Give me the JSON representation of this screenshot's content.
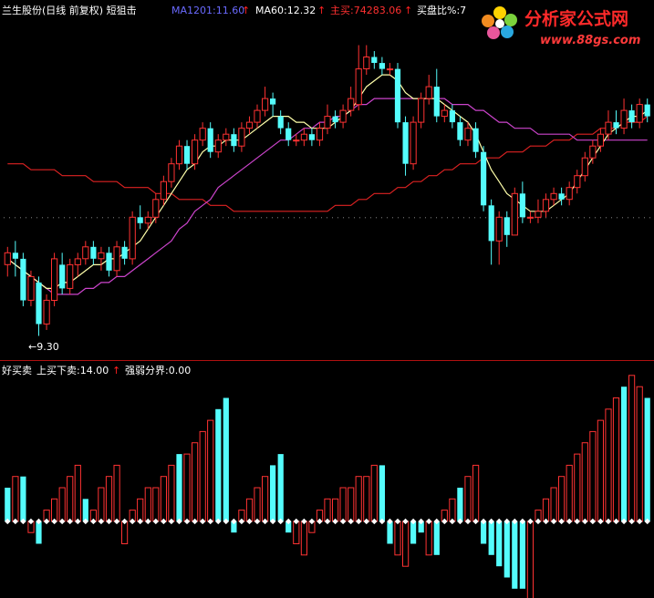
{
  "upper_header": {
    "stock_title": "兰生股份(日线 前复权) 短狙击",
    "indicators": [
      {
        "label": "MA1201:11.60",
        "color": "#6a6aff"
      },
      {
        "label": "MA60:12.32",
        "color": "#ffffff"
      },
      {
        "label": "主买:74283.06",
        "color": "#ff3030"
      },
      {
        "label": "买盘比%:7",
        "color": "#ffffff"
      }
    ],
    "arrow_color": "#ff2020",
    "arrow_glyph": "↑"
  },
  "lower_header": {
    "title": "好买卖",
    "indicators": [
      {
        "label": "上买下卖:14.00",
        "color": "#ffffff"
      },
      {
        "label": "强弱分界:0.00",
        "color": "#ffffff"
      }
    ]
  },
  "price_marker": {
    "label": "←9.30"
  },
  "watermark": {
    "brand": "分析家公式网",
    "url": "www.88gs.com"
  },
  "colors": {
    "up": "#ff3232",
    "down": "#54fcfc",
    "ma_short": "#ffffaa",
    "ma_mid": "#cc44cc",
    "ma_long": "#dd2222",
    "divider": "#b01010",
    "zero_marker": "#ffffff"
  },
  "chart_data": [
    {
      "type": "candlestick",
      "title": "兰生股份(日线 前复权) 短狙击",
      "ylim": [
        9.0,
        14.5
      ],
      "candles": [
        [
          10.5,
          10.7,
          10.8,
          10.3
        ],
        [
          10.7,
          10.6,
          10.9,
          10.3
        ],
        [
          10.6,
          9.9,
          10.7,
          9.8
        ],
        [
          9.9,
          10.3,
          10.4,
          9.8
        ],
        [
          10.2,
          9.5,
          10.3,
          9.3
        ],
        [
          9.5,
          9.9,
          10.0,
          9.4
        ],
        [
          9.9,
          10.6,
          10.7,
          9.8
        ],
        [
          10.5,
          10.1,
          10.7,
          10.0
        ],
        [
          10.1,
          10.5,
          10.6,
          10.0
        ],
        [
          10.5,
          10.6,
          10.7,
          10.3
        ],
        [
          10.6,
          10.8,
          10.9,
          10.5
        ],
        [
          10.8,
          10.6,
          10.9,
          10.5
        ],
        [
          10.6,
          10.7,
          10.8,
          10.4
        ],
        [
          10.7,
          10.4,
          10.8,
          10.3
        ],
        [
          10.4,
          10.8,
          10.9,
          10.3
        ],
        [
          10.8,
          10.6,
          10.9,
          10.5
        ],
        [
          10.6,
          11.3,
          11.4,
          10.5
        ],
        [
          11.3,
          11.2,
          11.5,
          11.1
        ],
        [
          11.2,
          11.3,
          11.4,
          11.1
        ],
        [
          11.3,
          11.6,
          11.7,
          11.2
        ],
        [
          11.6,
          11.9,
          12.0,
          11.5
        ],
        [
          11.9,
          12.2,
          12.3,
          11.8
        ],
        [
          12.2,
          12.5,
          12.6,
          12.1
        ],
        [
          12.5,
          12.2,
          12.6,
          12.1
        ],
        [
          12.2,
          12.6,
          12.7,
          12.1
        ],
        [
          12.6,
          12.8,
          12.9,
          12.5
        ],
        [
          12.8,
          12.4,
          12.9,
          12.3
        ],
        [
          12.4,
          12.6,
          12.7,
          12.3
        ],
        [
          12.6,
          12.7,
          12.8,
          12.5
        ],
        [
          12.7,
          12.5,
          12.8,
          12.4
        ],
        [
          12.5,
          12.8,
          12.9,
          12.4
        ],
        [
          12.8,
          12.9,
          13.0,
          12.7
        ],
        [
          12.9,
          13.1,
          13.2,
          12.8
        ],
        [
          13.1,
          13.3,
          13.5,
          13.0
        ],
        [
          13.3,
          13.2,
          13.4,
          13.0
        ],
        [
          13.0,
          12.8,
          13.1,
          12.7
        ],
        [
          12.8,
          12.6,
          12.9,
          12.5
        ],
        [
          12.6,
          12.6,
          12.7,
          12.5
        ],
        [
          12.6,
          12.7,
          12.8,
          12.5
        ],
        [
          12.7,
          12.6,
          12.8,
          12.5
        ],
        [
          12.6,
          12.8,
          12.9,
          12.5
        ],
        [
          12.8,
          13.0,
          13.2,
          12.7
        ],
        [
          13.0,
          12.9,
          13.1,
          12.8
        ],
        [
          12.9,
          13.1,
          13.2,
          12.8
        ],
        [
          13.1,
          13.3,
          13.5,
          13.0
        ],
        [
          13.2,
          13.8,
          14.2,
          13.1
        ],
        [
          13.8,
          14.0,
          14.2,
          13.7
        ],
        [
          14.0,
          13.9,
          14.1,
          13.8
        ],
        [
          13.9,
          13.8,
          14.0,
          13.7
        ],
        [
          13.8,
          13.8,
          13.9,
          13.7
        ],
        [
          13.8,
          12.9,
          13.9,
          12.8
        ],
        [
          12.9,
          12.2,
          13.0,
          12.0
        ],
        [
          12.2,
          12.9,
          13.0,
          12.1
        ],
        [
          12.9,
          13.3,
          13.4,
          12.8
        ],
        [
          13.3,
          13.5,
          13.7,
          13.2
        ],
        [
          13.5,
          13.0,
          13.8,
          12.9
        ],
        [
          13.0,
          13.1,
          13.2,
          12.9
        ],
        [
          13.1,
          12.9,
          13.2,
          12.8
        ],
        [
          12.9,
          12.6,
          13.0,
          12.5
        ],
        [
          12.6,
          12.8,
          12.9,
          12.5
        ],
        [
          12.8,
          12.4,
          12.9,
          12.3
        ],
        [
          12.4,
          11.5,
          12.5,
          11.4
        ],
        [
          11.5,
          10.9,
          11.6,
          10.5
        ],
        [
          10.9,
          11.3,
          11.4,
          10.5
        ],
        [
          11.3,
          11.0,
          11.4,
          10.8
        ],
        [
          11.0,
          11.7,
          11.8,
          11.0
        ],
        [
          11.7,
          11.3,
          11.9,
          11.2
        ],
        [
          11.3,
          11.3,
          11.4,
          11.2
        ],
        [
          11.3,
          11.4,
          11.6,
          11.2
        ],
        [
          11.4,
          11.6,
          11.7,
          11.3
        ],
        [
          11.6,
          11.7,
          11.8,
          11.5
        ],
        [
          11.7,
          11.6,
          11.8,
          11.5
        ],
        [
          11.6,
          11.8,
          11.9,
          11.5
        ],
        [
          11.8,
          12.0,
          12.1,
          11.7
        ],
        [
          12.0,
          12.3,
          12.4,
          11.9
        ],
        [
          12.3,
          12.5,
          12.6,
          12.2
        ],
        [
          12.5,
          12.7,
          12.8,
          12.4
        ],
        [
          12.7,
          12.9,
          13.1,
          12.6
        ],
        [
          12.9,
          12.8,
          13.1,
          12.7
        ],
        [
          12.8,
          13.1,
          13.3,
          12.7
        ],
        [
          13.1,
          12.9,
          13.2,
          12.8
        ],
        [
          12.9,
          13.2,
          13.3,
          12.8
        ],
        [
          13.2,
          13.0,
          13.3,
          12.9
        ]
      ],
      "ma_short": [
        10.6,
        10.5,
        10.4,
        10.3,
        10.2,
        10.1,
        10.1,
        10.2,
        10.2,
        10.3,
        10.4,
        10.5,
        10.5,
        10.6,
        10.6,
        10.7,
        10.8,
        10.9,
        11.1,
        11.3,
        11.5,
        11.7,
        11.9,
        12.1,
        12.2,
        12.4,
        12.5,
        12.5,
        12.6,
        12.6,
        12.6,
        12.7,
        12.8,
        12.9,
        13.0,
        13.0,
        13.0,
        12.9,
        12.9,
        12.8,
        12.8,
        12.8,
        12.9,
        13.0,
        13.1,
        13.3,
        13.5,
        13.6,
        13.7,
        13.7,
        13.6,
        13.4,
        13.3,
        13.3,
        13.3,
        13.3,
        13.2,
        13.1,
        13.0,
        12.9,
        12.7,
        12.4,
        12.1,
        11.9,
        11.7,
        11.6,
        11.5,
        11.4,
        11.4,
        11.4,
        11.5,
        11.6,
        11.7,
        11.9,
        12.1,
        12.3,
        12.5,
        12.7,
        12.8,
        12.9,
        13.0,
        13.0,
        13.1
      ],
      "ma_mid": [
        10.6,
        10.5,
        10.4,
        10.3,
        10.2,
        10.1,
        10.0,
        10.0,
        10.0,
        10.0,
        10.1,
        10.1,
        10.2,
        10.2,
        10.3,
        10.3,
        10.4,
        10.5,
        10.6,
        10.7,
        10.8,
        10.9,
        11.1,
        11.2,
        11.4,
        11.5,
        11.6,
        11.8,
        11.9,
        12.0,
        12.1,
        12.2,
        12.3,
        12.4,
        12.5,
        12.6,
        12.6,
        12.7,
        12.8,
        12.8,
        12.9,
        12.9,
        13.0,
        13.0,
        13.1,
        13.2,
        13.2,
        13.3,
        13.3,
        13.3,
        13.3,
        13.3,
        13.3,
        13.3,
        13.3,
        13.3,
        13.3,
        13.2,
        13.2,
        13.2,
        13.1,
        13.1,
        13.0,
        12.9,
        12.9,
        12.8,
        12.8,
        12.8,
        12.7,
        12.7,
        12.7,
        12.7,
        12.7,
        12.6,
        12.6,
        12.6,
        12.6,
        12.6,
        12.6,
        12.6,
        12.6,
        12.6,
        12.6
      ],
      "ma_long": [
        12.2,
        12.2,
        12.2,
        12.1,
        12.1,
        12.1,
        12.1,
        12.0,
        12.0,
        12.0,
        12.0,
        11.9,
        11.9,
        11.9,
        11.9,
        11.8,
        11.8,
        11.8,
        11.8,
        11.7,
        11.7,
        11.7,
        11.6,
        11.6,
        11.6,
        11.6,
        11.5,
        11.5,
        11.5,
        11.4,
        11.4,
        11.4,
        11.4,
        11.4,
        11.4,
        11.4,
        11.4,
        11.4,
        11.4,
        11.4,
        11.4,
        11.4,
        11.5,
        11.5,
        11.5,
        11.6,
        11.6,
        11.7,
        11.7,
        11.7,
        11.8,
        11.8,
        11.9,
        11.9,
        12.0,
        12.0,
        12.1,
        12.1,
        12.2,
        12.2,
        12.2,
        12.3,
        12.3,
        12.3,
        12.4,
        12.4,
        12.4,
        12.5,
        12.5,
        12.5,
        12.6,
        12.6,
        12.6,
        12.7,
        12.7,
        12.7,
        12.8,
        12.8,
        12.8,
        12.9,
        12.9,
        12.9,
        13.0
      ]
    },
    {
      "type": "bar",
      "title": "好买卖",
      "ylim": [
        -6.5,
        12.5
      ],
      "values": [
        3,
        4,
        4,
        -1,
        -2,
        1,
        2,
        3,
        4,
        5,
        2,
        1,
        3,
        4,
        5,
        -2,
        1,
        2,
        3,
        3,
        4,
        5,
        6,
        6,
        7,
        8,
        9,
        10,
        11,
        -1,
        1,
        2,
        3,
        4,
        5,
        6,
        -1,
        -2,
        -3,
        -1,
        1,
        2,
        2,
        3,
        3,
        4,
        4,
        5,
        5,
        -2,
        -3,
        -4,
        -2,
        -1,
        -3,
        -3,
        1,
        2,
        3,
        4,
        5,
        -2,
        -3,
        -4,
        -5,
        -6,
        -6,
        -8,
        1,
        2,
        3,
        4,
        5,
        6,
        7,
        8,
        9,
        10,
        11,
        12,
        13,
        12,
        11
      ],
      "colors": [
        "down",
        "up",
        "down",
        "up",
        "down",
        "up",
        "up",
        "up",
        "up",
        "up",
        "down",
        "up",
        "up",
        "up",
        "up",
        "up",
        "up",
        "up",
        "up",
        "up",
        "up",
        "up",
        "down",
        "up",
        "up",
        "up",
        "up",
        "down",
        "down",
        "down",
        "up",
        "up",
        "up",
        "up",
        "down",
        "down",
        "down",
        "up",
        "up",
        "up",
        "up",
        "up",
        "up",
        "up",
        "up",
        "up",
        "up",
        "up",
        "down",
        "down",
        "up",
        "up",
        "down",
        "down",
        "up",
        "down",
        "up",
        "up",
        "down",
        "up",
        "up",
        "down",
        "down",
        "down",
        "down",
        "down",
        "down",
        "up",
        "up",
        "up",
        "up",
        "up",
        "up",
        "up",
        "up",
        "up",
        "up",
        "up",
        "up",
        "down",
        "up",
        "up",
        "down"
      ]
    }
  ]
}
